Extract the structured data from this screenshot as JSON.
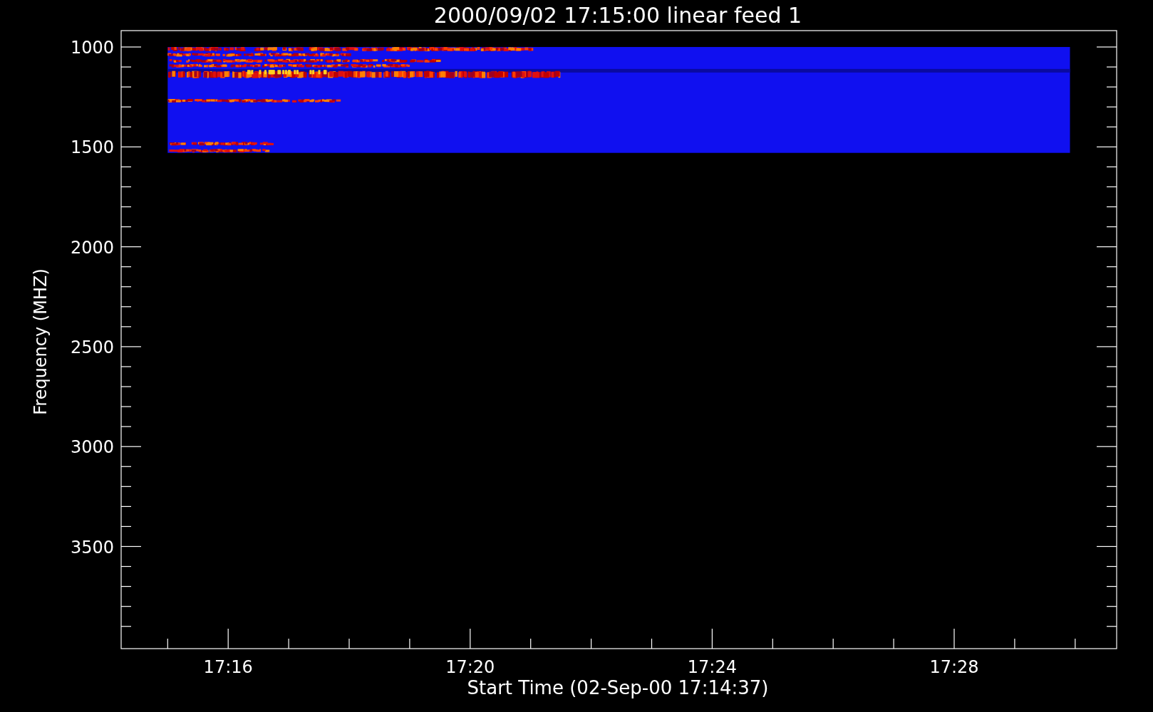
{
  "plot": {
    "title": "2000/09/02 17:15:00 linear feed 1",
    "xlabel": "Start Time (02-Sep-00 17:14:37)",
    "ylabel": "Frequency (MHZ)",
    "xticks": [
      "17:16",
      "17:20",
      "17:24",
      "17:28"
    ],
    "yticks": [
      "1000",
      "1500",
      "2000",
      "2500",
      "3000",
      "3500"
    ]
  }
}
